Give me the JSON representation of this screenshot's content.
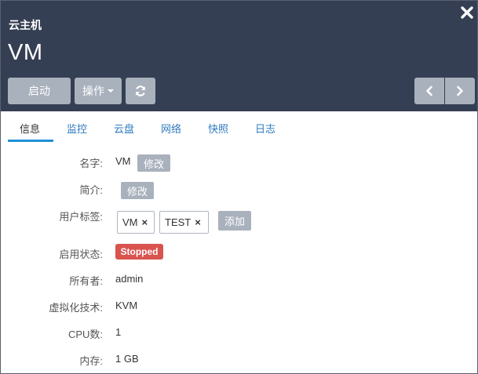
{
  "header": {
    "subtitle": "云主机",
    "title": "VM",
    "buttons": {
      "start": "启动",
      "operations": "操作"
    }
  },
  "tabs": [
    {
      "label": "信息",
      "active": true
    },
    {
      "label": "监控",
      "active": false
    },
    {
      "label": "云盘",
      "active": false
    },
    {
      "label": "网络",
      "active": false
    },
    {
      "label": "快照",
      "active": false
    },
    {
      "label": "日志",
      "active": false
    }
  ],
  "info": {
    "name": {
      "label": "名字:",
      "value": "VM",
      "edit_button": "修改"
    },
    "description": {
      "label": "简介:",
      "edit_button": "修改"
    },
    "tags": {
      "label": "用户标签:",
      "items": [
        "VM",
        "TEST"
      ],
      "add_button": "添加"
    },
    "state": {
      "label": "启用状态:",
      "value": "Stopped",
      "color": "#d9534f"
    },
    "owner": {
      "label": "所有者:",
      "value": "admin"
    },
    "hypervisor": {
      "label": "虚拟化技术:",
      "value": "KVM"
    },
    "cpu": {
      "label": "CPU数:",
      "value": "1"
    },
    "memory": {
      "label": "内存:",
      "value": "1 GB"
    }
  },
  "icons": {
    "close": "close-icon",
    "refresh": "refresh-icon",
    "prev": "chevron-left-icon",
    "next": "chevron-right-icon",
    "tag_remove": "x-icon"
  },
  "colors": {
    "header_bg": "#353f53",
    "button_gray": "#a9b1bd",
    "link_blue": "#2f7bbf",
    "tab_active_underline": "#1e90d8"
  }
}
